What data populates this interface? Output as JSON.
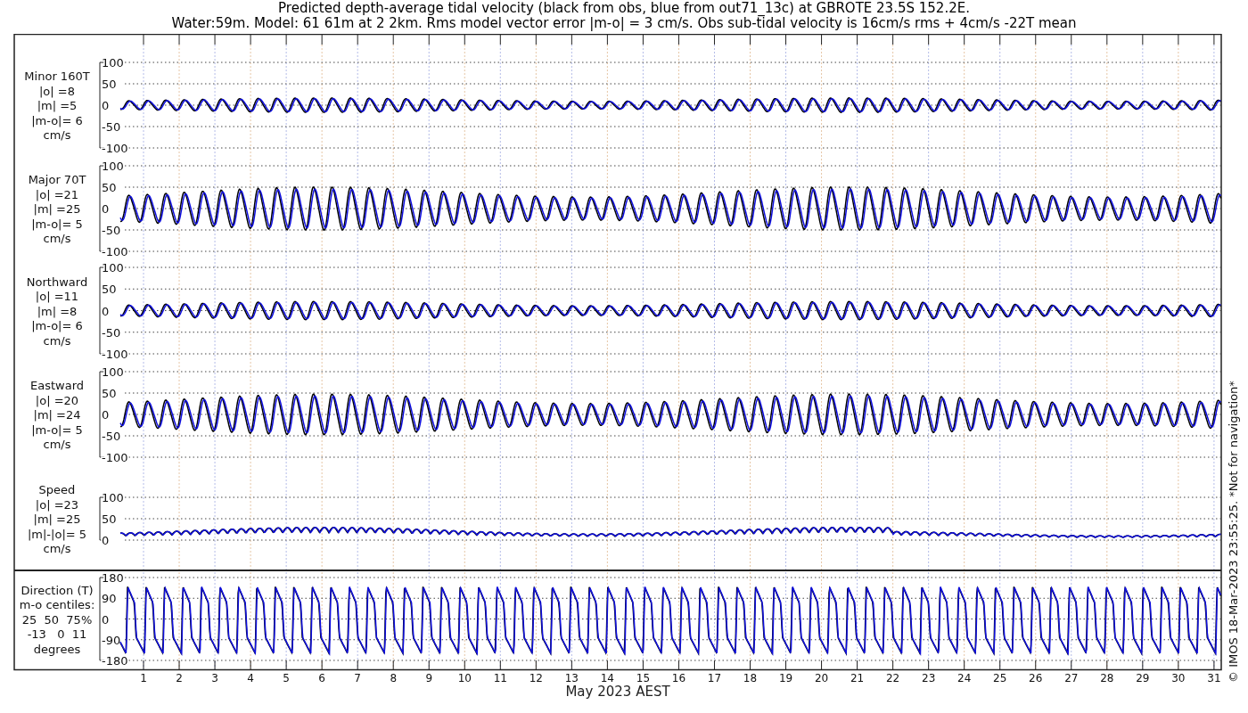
{
  "title_lines": [
    "Predicted depth-average tidal velocity (black from obs, blue from out71_13c) at GBROTE 23.5S 152.2E.",
    "Water:59m. Model: 61 61m at 2 2km. Rms model vector error |m-o| = 3 cm/s. Obs sub-tidal velocity is 16cm/s rms + 4cm/s -22T mean"
  ],
  "panels": [
    {
      "kind": "signed",
      "label_lines": [
        "Minor 160T",
        "|o| =8",
        "|m| =5",
        "|m-o|= 6",
        "cm/s"
      ],
      "yticks": [
        "100",
        "50",
        "0",
        "-50",
        "-100"
      ]
    },
    {
      "kind": "signed",
      "label_lines": [
        "Major 70T",
        "|o| =21",
        "|m| =25",
        "|m-o|= 5",
        "cm/s"
      ],
      "yticks": [
        "100",
        "50",
        "0",
        "-50",
        "-100"
      ]
    },
    {
      "kind": "signed",
      "label_lines": [
        "Northward",
        "|o| =11",
        "|m| =8",
        "|m-o|= 6",
        "cm/s"
      ],
      "yticks": [
        "100",
        "50",
        "0",
        "-50",
        "-100"
      ]
    },
    {
      "kind": "signed",
      "label_lines": [
        "Eastward",
        "|o| =20",
        "|m| =24",
        "|m-o|= 5",
        "cm/s"
      ],
      "yticks": [
        "100",
        "50",
        "0",
        "-50",
        "-100"
      ]
    },
    {
      "kind": "speed",
      "label_lines": [
        "Speed",
        "|o| =23",
        "|m| =25",
        "|m|-|o|= 5",
        "cm/s"
      ],
      "yticks": [
        "100",
        "50",
        "0"
      ]
    },
    {
      "kind": "direction",
      "label_lines": [
        "Direction (T)",
        "m-o centiles:",
        "25  50  75%",
        "-13   0  11",
        "degrees"
      ],
      "yticks": [
        "180",
        "90",
        "0",
        "-90",
        "-180"
      ]
    }
  ],
  "days": [
    "1",
    "2",
    "3",
    "4",
    "5",
    "6",
    "7",
    "8",
    "9",
    "10",
    "11",
    "12",
    "13",
    "14",
    "15",
    "16",
    "17",
    "18",
    "19",
    "20",
    "21",
    "22",
    "23",
    "24",
    "25",
    "26",
    "27",
    "28",
    "29",
    "30",
    "31"
  ],
  "xlabel": "May 2023 AEST",
  "credit": "© IMOS 18-Mar-2023 23:55:25. *Not for navigation*"
}
